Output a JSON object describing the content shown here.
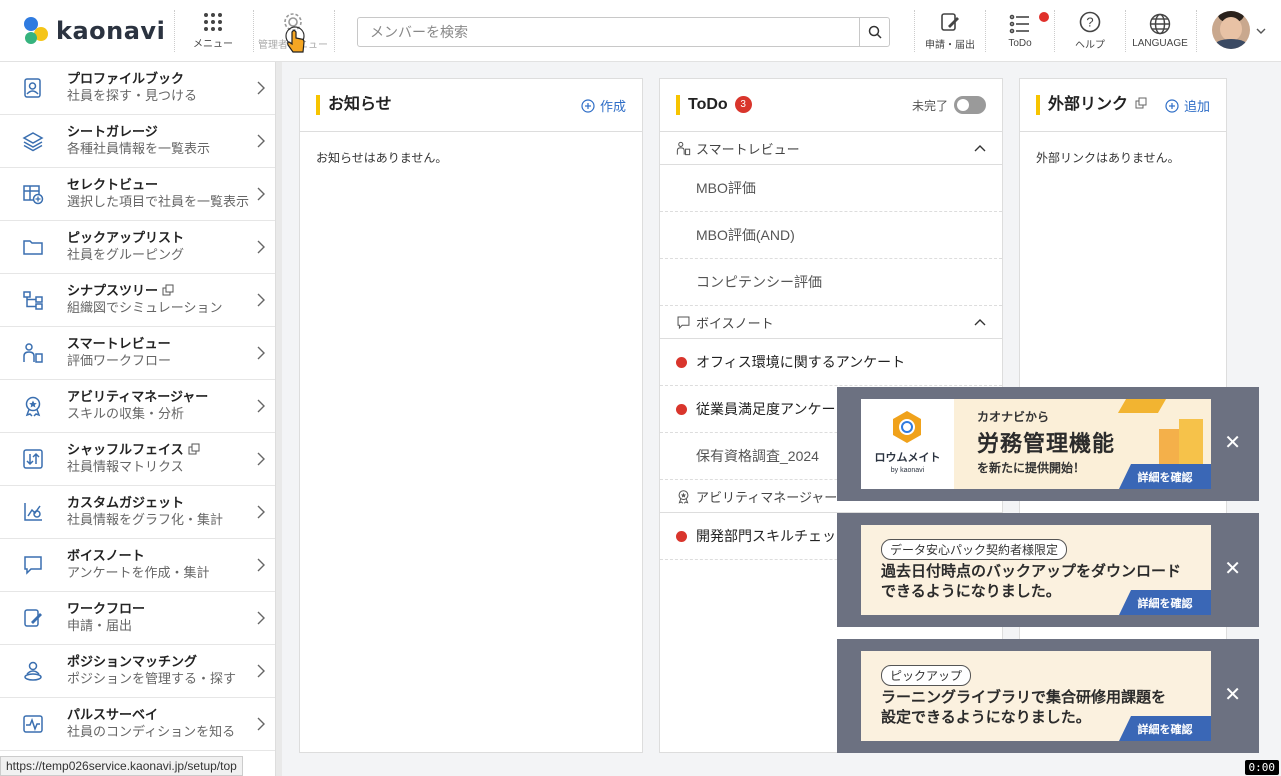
{
  "app": {
    "logo_text": "kaonavi"
  },
  "header": {
    "menu_label": "メニュー",
    "admin_label": "管理者メニュー",
    "search_placeholder": "メンバーを検索",
    "apply_label": "申請・届出",
    "todo_label": "ToDo",
    "help_label": "ヘルプ",
    "language_label": "LANGUAGE"
  },
  "sidebar": {
    "items": [
      {
        "title": "プロファイルブック",
        "sub": "社員を探す・見つける",
        "icon": "profile-book-icon"
      },
      {
        "title": "シートガレージ",
        "sub": "各種社員情報を一覧表示",
        "icon": "layers-icon"
      },
      {
        "title": "セレクトビュー",
        "sub": "選択した項目で社員を一覧表示",
        "icon": "table-plus-icon"
      },
      {
        "title": "ピックアップリスト",
        "sub": "社員をグルーピング",
        "icon": "folder-icon"
      },
      {
        "title": "シナプスツリー",
        "sub": "組織図でシミュレーション",
        "icon": "org-tree-icon",
        "external": true
      },
      {
        "title": "スマートレビュー",
        "sub": "評価ワークフロー",
        "icon": "review-icon"
      },
      {
        "title": "アビリティマネージャー",
        "sub": "スキルの収集・分析",
        "icon": "badge-icon"
      },
      {
        "title": "シャッフルフェイス",
        "sub": "社員情報マトリクス",
        "icon": "shuffle-icon",
        "external": true
      },
      {
        "title": "カスタムガジェット",
        "sub": "社員情報をグラフ化・集計",
        "icon": "chart-icon"
      },
      {
        "title": "ボイスノート",
        "sub": "アンケートを作成・集計",
        "icon": "speech-bubble-icon"
      },
      {
        "title": "ワークフロー",
        "sub": "申請・届出",
        "icon": "workflow-icon"
      },
      {
        "title": "ポジションマッチング",
        "sub": "ポジションを管理する・探す",
        "icon": "position-icon"
      },
      {
        "title": "パルスサーベイ",
        "sub": "社員のコンディションを知る",
        "icon": "pulse-icon"
      }
    ]
  },
  "status_url": "https://temp026service.kaonavi.jp/setup/top",
  "notices": {
    "title": "お知らせ",
    "action": "作成",
    "empty": "お知らせはありません。"
  },
  "todo": {
    "title": "ToDo",
    "count": "3",
    "toggle_label": "未完了",
    "sections": [
      {
        "name": "スマートレビュー",
        "items": [
          {
            "label": "MBO評価",
            "alert": false
          },
          {
            "label": "MBO評価(AND)",
            "alert": false
          },
          {
            "label": "コンピテンシー評価",
            "alert": false
          }
        ]
      },
      {
        "name": "ボイスノート",
        "items": [
          {
            "label": "オフィス環境に関するアンケート",
            "alert": true
          },
          {
            "label": "従業員満足度アンケート",
            "alert": true
          },
          {
            "label": "保有資格調査_2024",
            "alert": false
          }
        ]
      },
      {
        "name": "アビリティマネージャー",
        "items": [
          {
            "label": "開発部門スキルチェック",
            "alert": true
          }
        ]
      }
    ]
  },
  "links": {
    "title": "外部リンク",
    "action": "追加",
    "empty": "外部リンクはありません。"
  },
  "toasts": [
    {
      "brand_name": "ロウムメイト",
      "brand_by": "by kaonavi",
      "line1": "カオナビから",
      "line2": "労務管理機能",
      "line3": "を新たに提供開始！",
      "button": "詳細を確認"
    },
    {
      "tag": "データ安心パック契約者様限定",
      "message_1": "過去日付時点のバックアップをダウンロード",
      "message_2": "できるようになりました。",
      "button": "詳細を確認"
    },
    {
      "tag": "ピックアップ",
      "message_1": "ラーニングライブラリで集合研修用課題を",
      "message_2": "設定できるようになりました。",
      "button": "詳細を確認"
    }
  ],
  "time_badge": "0:00",
  "colors": {
    "accent_yellow": "#f7c400",
    "link_blue": "#2f6ec7",
    "alert_red": "#d9352c",
    "toast_bg": "#6c7181"
  }
}
